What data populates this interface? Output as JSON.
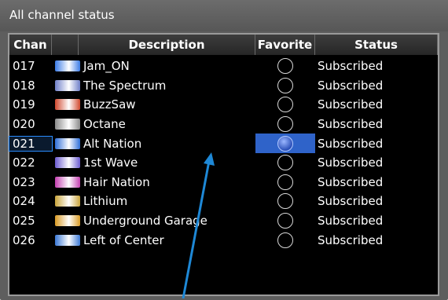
{
  "window": {
    "title": "All channel status"
  },
  "columns": {
    "chan": "Chan",
    "description": "Description",
    "favorite": "Favorite",
    "status": "Status"
  },
  "rows": [
    {
      "chan": "017",
      "name": "Jam_ON",
      "status": "Subscribed",
      "logo": "jam-on-logo",
      "logo_color": "#3b7be6"
    },
    {
      "chan": "018",
      "name": "The Spectrum",
      "status": "Subscribed",
      "logo": "spectrum-logo",
      "logo_color": "#6f7fc8"
    },
    {
      "chan": "019",
      "name": "BuzzSaw",
      "status": "Subscribed",
      "logo": "buzzsaw-logo",
      "logo_color": "#d0492f"
    },
    {
      "chan": "020",
      "name": "Octane",
      "status": "Subscribed",
      "logo": "octane-logo",
      "logo_color": "#8a8a8a"
    },
    {
      "chan": "021",
      "name": "Alt Nation",
      "status": "Subscribed",
      "logo": "alt-nation-logo",
      "logo_color": "#2f6fd8",
      "selected": true
    },
    {
      "chan": "022",
      "name": "1st Wave",
      "status": "Subscribed",
      "logo": "1st-wave-logo",
      "logo_color": "#6a5ad0"
    },
    {
      "chan": "023",
      "name": "Hair Nation",
      "status": "Subscribed",
      "logo": "hair-nation-logo",
      "logo_color": "#c43fb0"
    },
    {
      "chan": "024",
      "name": "Lithium",
      "status": "Subscribed",
      "logo": "lithium-logo",
      "logo_color": "#c9a43a"
    },
    {
      "chan": "025",
      "name": "Underground Garage",
      "status": "Subscribed",
      "logo": "underground-garage-logo",
      "logo_color": "#d99a23"
    },
    {
      "chan": "026",
      "name": "Left of Center",
      "status": "Subscribed",
      "logo": "left-of-center-logo",
      "logo_color": "#3a78d6"
    }
  ],
  "colors": {
    "selection": "#2f63c9",
    "arrow": "#1e88d6"
  }
}
